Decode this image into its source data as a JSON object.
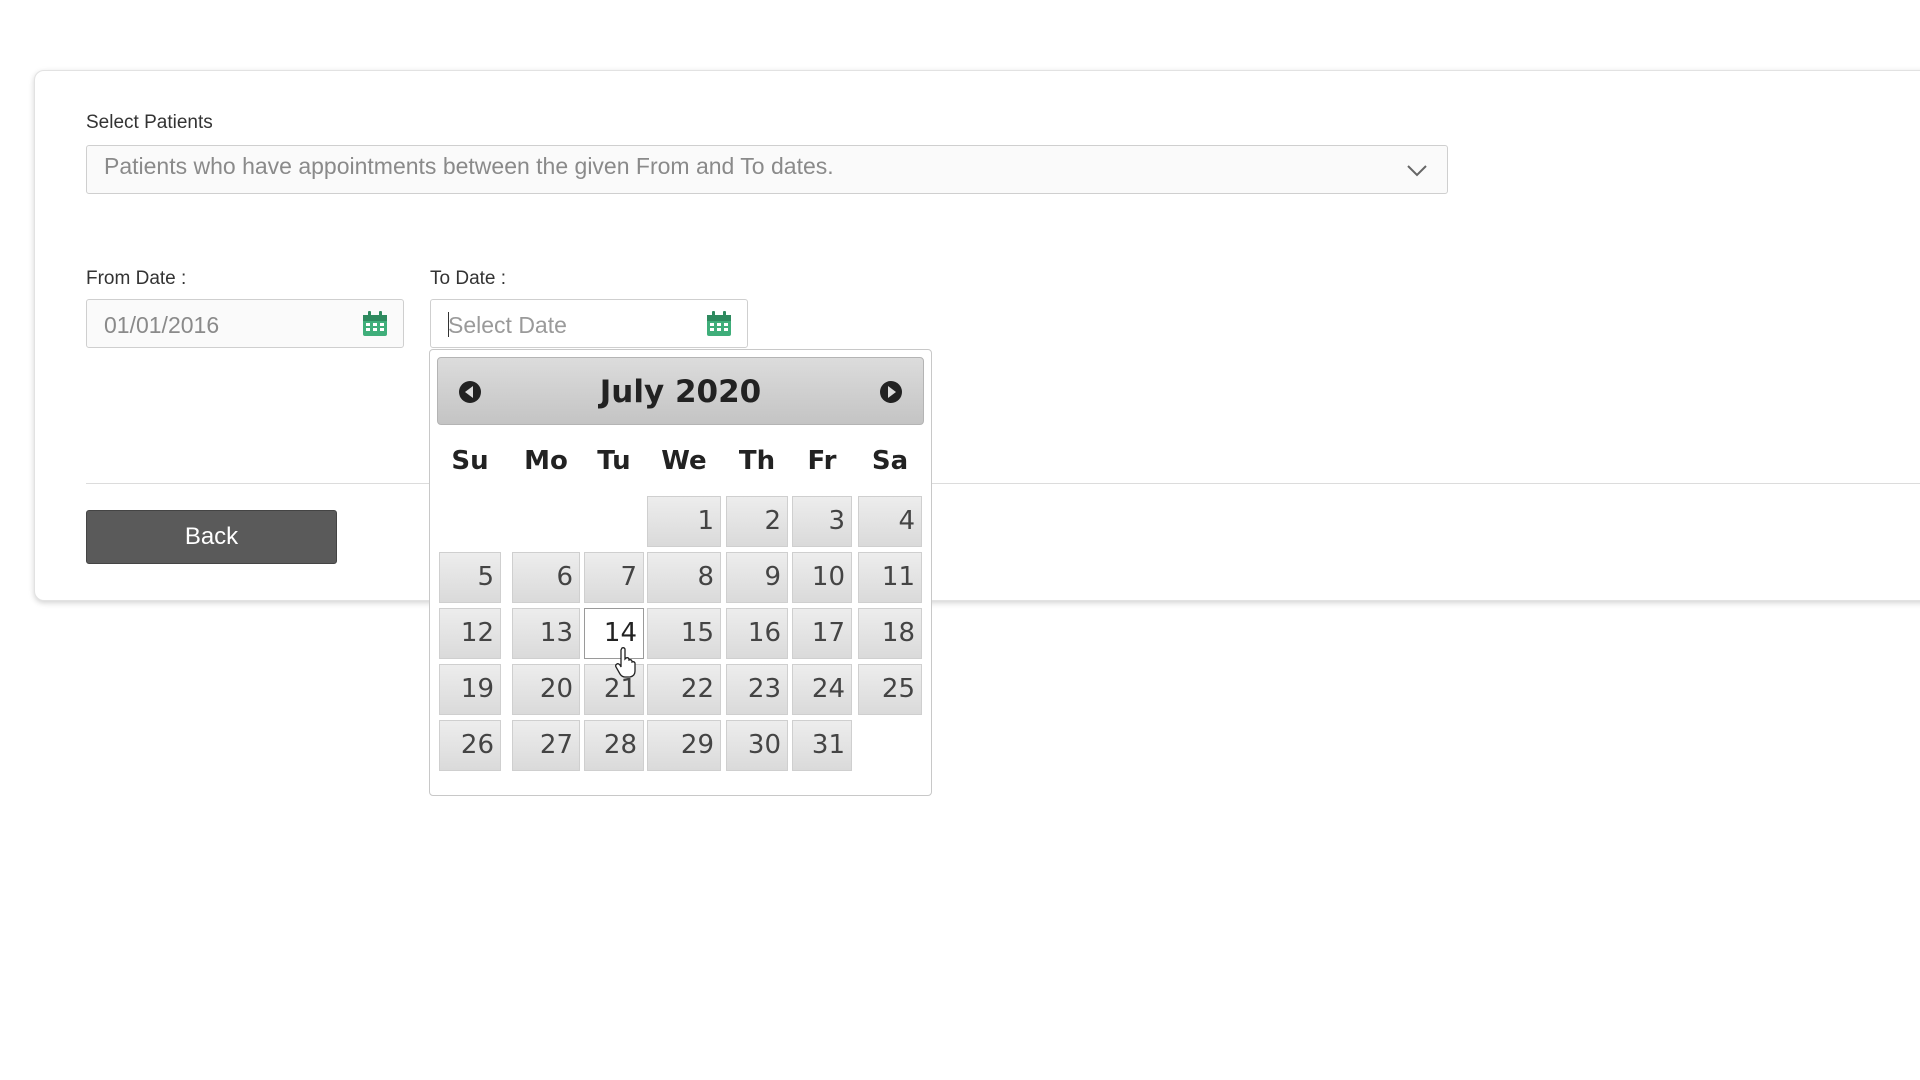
{
  "form": {
    "select_patients_label": "Select Patients",
    "select_patients_value": "Patients who have appointments between the given From and To dates.",
    "from_date_label": "From Date :",
    "from_date_value": "01/01/2016",
    "to_date_label": "To Date :",
    "to_date_placeholder": "Select Date",
    "back_label": "Back"
  },
  "datepicker": {
    "title": "July 2020",
    "weekdays": [
      "Su",
      "Mo",
      "Tu",
      "We",
      "Th",
      "Fr",
      "Sa"
    ],
    "first_weekday_index": 3,
    "days_in_month": 31,
    "highlighted_day": 14,
    "prev_icon": "prev-arrow-icon",
    "next_icon": "next-arrow-icon"
  },
  "colors": {
    "calendar_icon": "#3fae7a",
    "button_bg": "#5a5a5a"
  }
}
